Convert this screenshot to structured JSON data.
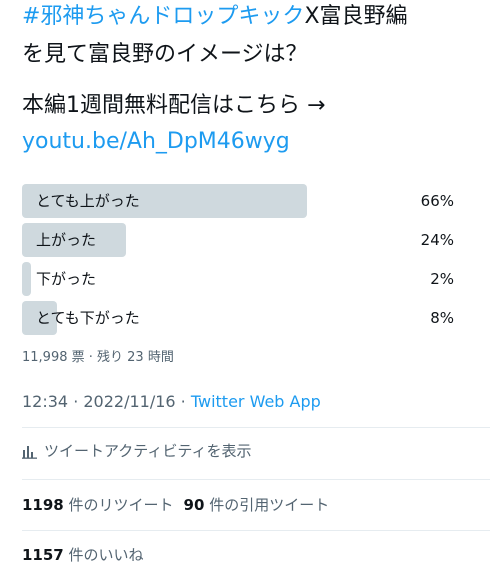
{
  "tweet": {
    "line1_hashtag": "#邪神ちゃんドロップキック",
    "line1_rest": "X富良野編",
    "line2": "を見て富良野のイメージは？",
    "line3": "本編1週間無料配信はこちら →",
    "link": "youtu.be/Ah_DpM46wyg"
  },
  "poll": {
    "options": [
      {
        "label": "とても上がった",
        "percent": "66%",
        "fraction": 0.66
      },
      {
        "label": "上がった",
        "percent": "24%",
        "fraction": 0.24
      },
      {
        "label": "下がった",
        "percent": "2%",
        "fraction": 0.02
      },
      {
        "label": "とても下がった",
        "percent": "8%",
        "fraction": 0.08
      }
    ],
    "votes": "11,998 票",
    "remaining": "残り 23 時間"
  },
  "meta": {
    "time": "12:34",
    "date": "2022/11/16",
    "source": "Twitter Web App"
  },
  "activity_label": "ツイートアクティビティを表示",
  "stats": {
    "retweets_count": "1198",
    "retweets_label": "件のリツイート",
    "quotes_count": "90",
    "quotes_label": "件の引用ツイート",
    "likes_count": "1157",
    "likes_label": "件のいいね"
  },
  "colors": {
    "accent": "#1d9bf0",
    "poll_bar": "#cfd9de",
    "secondary_text": "#536471"
  },
  "icons": [
    "chart-icon"
  ]
}
